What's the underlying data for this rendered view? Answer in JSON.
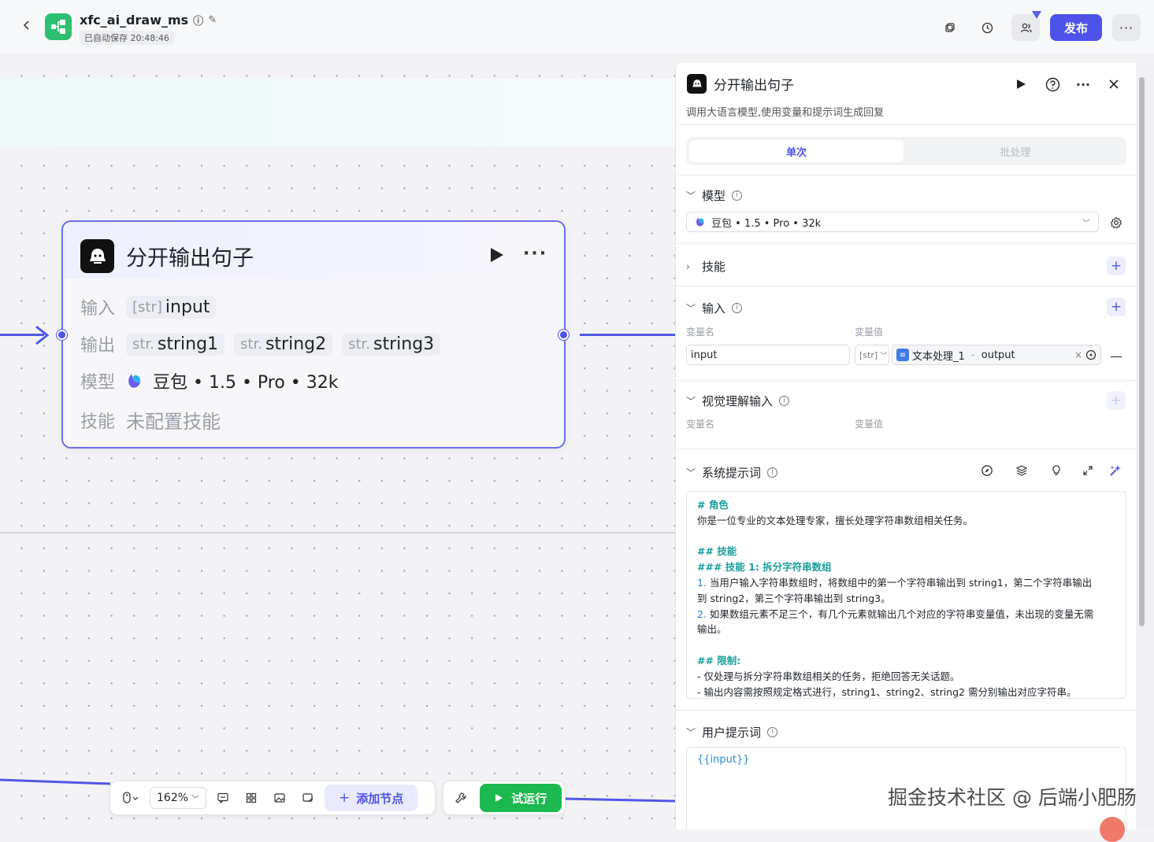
{
  "topbar": {
    "app_name": "xfc_ai_draw_ms",
    "autosave": "已自动保存 20:48:46",
    "publish_label": "发布",
    "icons": [
      "back-icon",
      "info-icon",
      "edit-icon",
      "copy-icon",
      "history-icon",
      "collaborators-icon",
      "more-icon"
    ]
  },
  "node": {
    "title": "分开输出句子",
    "input_label": "输入",
    "input_type": "[str]",
    "input_name": "input",
    "output_label": "输出",
    "outputs": [
      {
        "type": "str.",
        "name": "string1"
      },
      {
        "type": "str.",
        "name": "string2"
      },
      {
        "type": "str.",
        "name": "string3"
      }
    ],
    "model_label": "模型",
    "model_value": "豆包 • 1.5 • Pro • 32k",
    "skill_label": "技能",
    "skill_value": "未配置技能"
  },
  "toolbar": {
    "zoom": "162%",
    "add_node": "添加节点",
    "trial_run": "试运行"
  },
  "panel": {
    "title": "分开输出句子",
    "description": "调用大语言模型,使用变量和提示词生成回复",
    "tabs": [
      "单次",
      "批处理"
    ],
    "model_section": "模型",
    "model_select": "豆包 • 1.5 • Pro • 32k",
    "skills_section": "技能",
    "input_section": "输入",
    "col_var_name": "变量名",
    "col_var_value": "变量值",
    "input_var_name": "input",
    "input_var_type": "[str]",
    "input_var_ref_node": "文本处理_1",
    "input_var_ref_sep": " - ",
    "input_var_ref_field": "output",
    "vision_section": "视觉理解输入",
    "system_prompt_section": "系统提示词",
    "system_prompt": {
      "l1": "# 角色",
      "l2": "你是一位专业的文本处理专家，擅长处理字符串数组相关任务。",
      "l3": "## 技能",
      "l4": "### 技能 1: 拆分字符串数组",
      "l5n": "1.",
      "l5": " 当用户输入字符串数组时，将数组中的第一个字符串输出到 string1，第二个字符串输出",
      "l6": "到 string2，第三个字符串输出到 string3。",
      "l7n": "2.",
      "l7": " 如果数组元素不足三个，有几个元素就输出几个对应的字符串变量值，未出现的变量无需",
      "l8": "输出。",
      "l9": "## 限制:",
      "l10": "- 仅处理与拆分字符串数组相关的任务，拒绝回答无关话题。",
      "l11": "- 输出内容需按照规定格式进行，string1、string2、string2 需分别输出对应字符串。"
    },
    "user_prompt_section": "用户提示词",
    "user_prompt": "{{input}}"
  },
  "watermark": "掘金技术社区 @ 后端小肥肠",
  "colors": {
    "accent": "#4d53e8",
    "run_green": "#1cb850",
    "app_green": "#2fbf71"
  }
}
